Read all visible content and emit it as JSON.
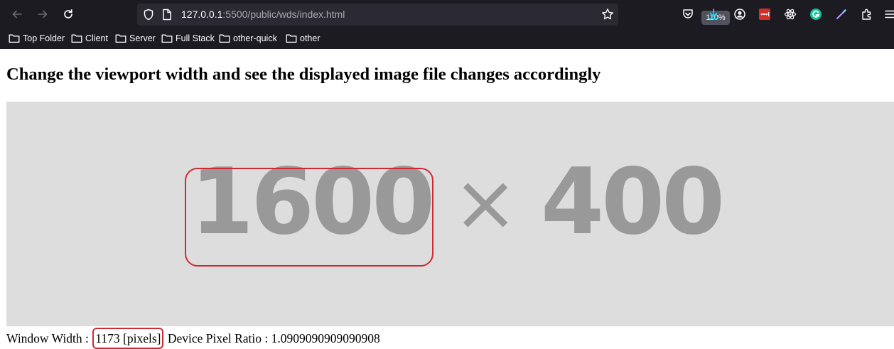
{
  "browser": {
    "url_host": "127.0.0.1",
    "url_rest": ":5500/public/wds/index.html",
    "zoom_level": "110%",
    "bookmarks": [
      "Top Folder",
      "Client",
      "Server",
      "Full Stack",
      "other-quick",
      "other"
    ],
    "icons": [
      "back-icon",
      "forward-icon",
      "reload-icon",
      "shield-icon",
      "page-icon",
      "star-icon",
      "pocket-icon",
      "download-icon",
      "account-icon",
      "lastpass-icon",
      "react-devtools-icon",
      "grammarly-icon",
      "color-picker-icon",
      "extensions-icon",
      "menu-icon"
    ],
    "colors": {
      "chrome": "#1c1b22",
      "urlbar": "#2b2a33",
      "download_accent": "#00ddff",
      "grammarly": "#15c39a",
      "lastpass": "#d32d27"
    }
  },
  "page": {
    "heading": "Change the viewport width and see the displayed image file changes accordingly",
    "placeholder": {
      "width_text": "1600",
      "times_text": "×",
      "height_text": "400",
      "bg_color": "#dddddd",
      "text_color": "#999999"
    },
    "window_width_label": "Window Width : ",
    "window_width_value": "1173 [pixels]",
    "dpr_label": " Device Pixel Ratio : ",
    "dpr_value": "1.0909090909090908",
    "highlight_color": "#cf2a32"
  }
}
